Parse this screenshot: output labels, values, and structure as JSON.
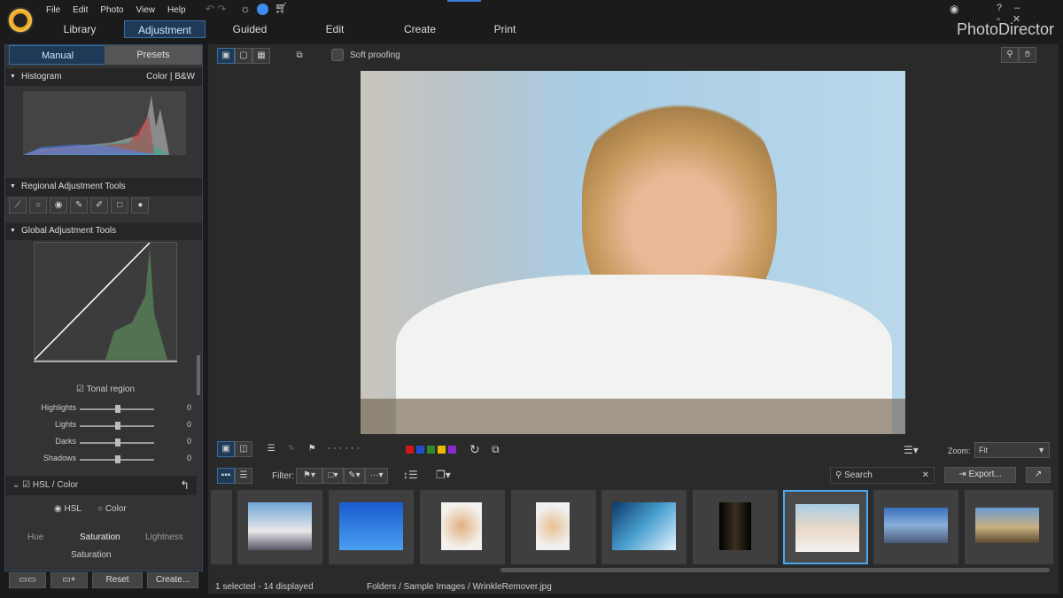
{
  "menu": [
    "File",
    "Edit",
    "Photo",
    "View",
    "Help"
  ],
  "modules": [
    "Library",
    "Adjustment",
    "Guided",
    "Edit",
    "Create",
    "Print"
  ],
  "brand": "PhotoDirector",
  "panel_tabs": [
    "Manual",
    "Presets"
  ],
  "histogram": {
    "title": "Histogram",
    "color": "Color",
    "bw": "B&W"
  },
  "regional": {
    "title": "Regional Adjustment Tools"
  },
  "global": {
    "title": "Global Adjustment Tools"
  },
  "tonal": {
    "label": "Tonal region",
    "sliders": [
      {
        "name": "Highlights",
        "value": "0"
      },
      {
        "name": "Lights",
        "value": "0"
      },
      {
        "name": "Darks",
        "value": "0"
      },
      {
        "name": "Shadows",
        "value": "0"
      }
    ]
  },
  "hsl": {
    "title": "HSL / Color",
    "radio_hsl": "HSL",
    "radio_color": "Color",
    "tabs": [
      "Hue",
      "Saturation",
      "Lightness"
    ],
    "sub": "Saturation"
  },
  "footer": {
    "reset": "Reset",
    "create": "Create..."
  },
  "toolbar": {
    "soft_proofing": "Soft proofing"
  },
  "bottom": {
    "zoom_label": "Zoom:",
    "zoom_value": "Fit",
    "filter": "Filter:",
    "search_placeholder": "Search",
    "export": "Export..."
  },
  "colors": [
    "#d01818",
    "#1f4fd0",
    "#2a8a2a",
    "#e6b800",
    "#8a2ad0"
  ],
  "status": {
    "selection": "1 selected - 14 displayed",
    "path": "Folders / Sample Images / WrinkleRemover.jpg"
  }
}
